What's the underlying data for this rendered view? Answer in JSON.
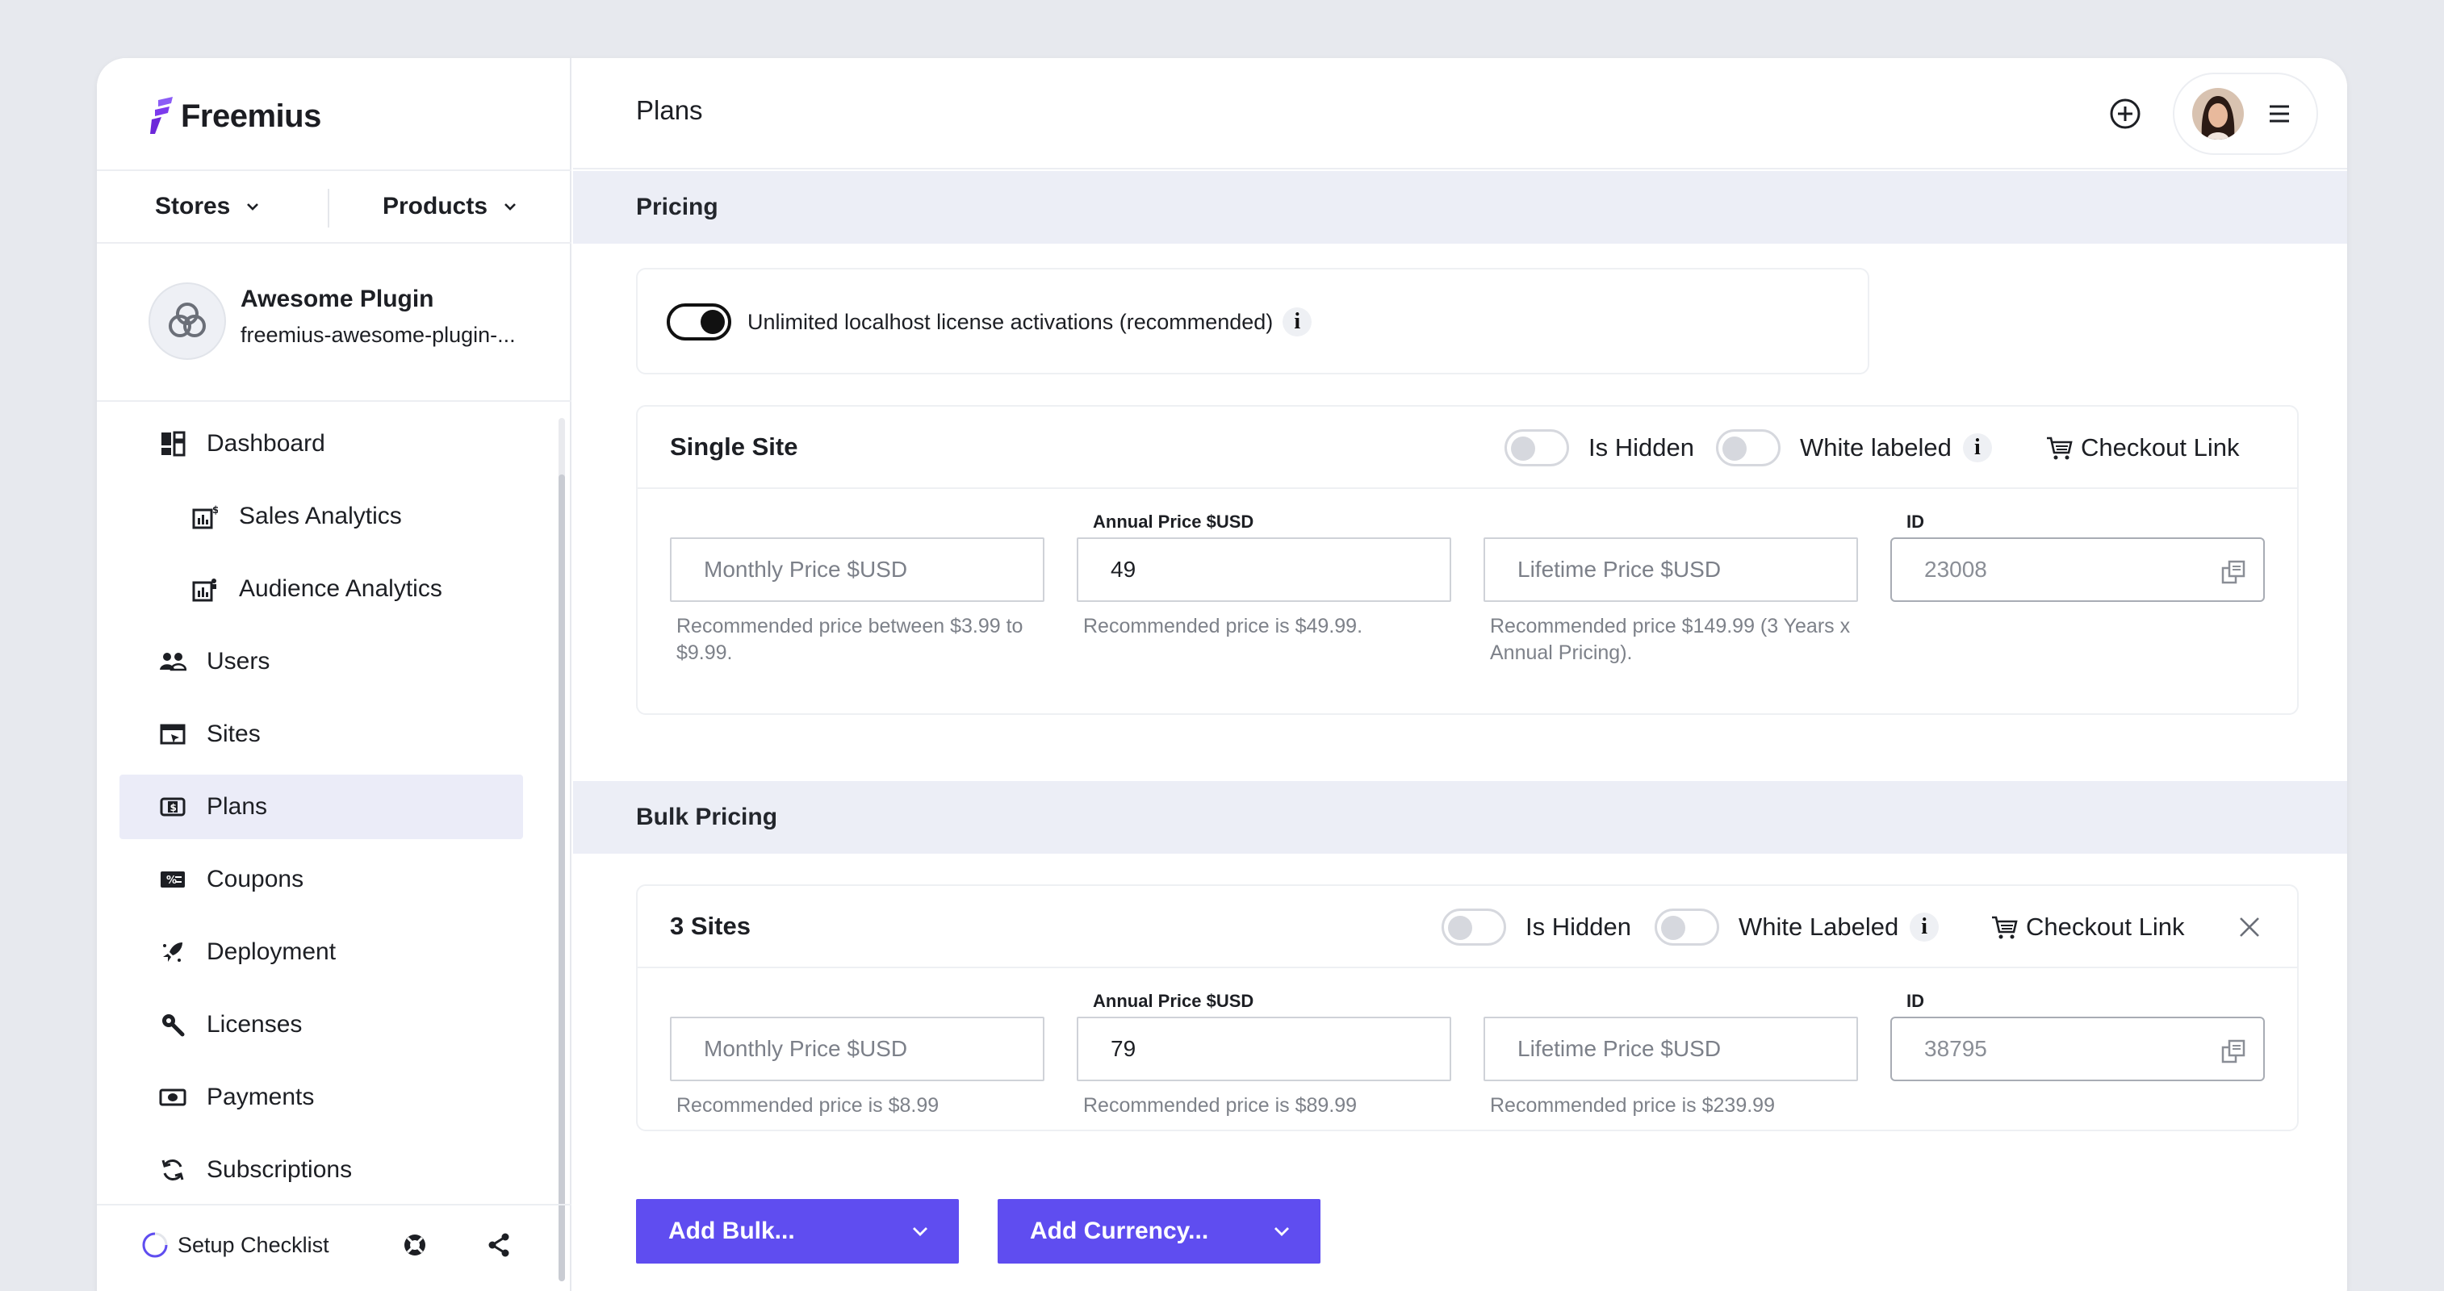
{
  "brand": {
    "name": "Freemius",
    "accent": "#5f4df0"
  },
  "switcher": {
    "stores": "Stores",
    "products": "Products"
  },
  "product": {
    "name": "Awesome Plugin",
    "slug": "freemius-awesome-plugin-..."
  },
  "sidebar": {
    "items": [
      {
        "label": "Dashboard",
        "icon": "dashboard-icon"
      },
      {
        "label": "Sales Analytics",
        "icon": "sales-analytics-icon"
      },
      {
        "label": "Audience Analytics",
        "icon": "audience-analytics-icon"
      },
      {
        "label": "Users",
        "icon": "users-icon"
      },
      {
        "label": "Sites",
        "icon": "sites-icon"
      },
      {
        "label": "Plans",
        "icon": "plans-icon",
        "active": true
      },
      {
        "label": "Coupons",
        "icon": "coupons-icon"
      },
      {
        "label": "Deployment",
        "icon": "deployment-icon"
      },
      {
        "label": "Licenses",
        "icon": "licenses-icon"
      },
      {
        "label": "Payments",
        "icon": "payments-icon"
      },
      {
        "label": "Subscriptions",
        "icon": "subscriptions-icon"
      }
    ]
  },
  "footer": {
    "setup_checklist": "Setup Checklist"
  },
  "header": {
    "title": "Plans"
  },
  "pricing": {
    "section_title": "Pricing",
    "localhost_label": "Unlimited localhost license activations (recommended)",
    "localhost_info": "i"
  },
  "single_site": {
    "title": "Single Site",
    "is_hidden": "Is Hidden",
    "white_labeled": "White labeled",
    "info": "i",
    "checkout_link": "Checkout Link",
    "monthly_placeholder": "Monthly Price $USD",
    "monthly_hint": "Recommended price between $3.99 to $9.99.",
    "annual_label": "Annual Price $USD",
    "annual_value": "49",
    "annual_hint": "Recommended price is $49.99.",
    "lifetime_placeholder": "Lifetime Price $USD",
    "lifetime_hint": "Recommended price $149.99 (3 Years x Annual Pricing).",
    "id_label": "ID",
    "id_value": "23008"
  },
  "bulk": {
    "section_title": "Bulk Pricing",
    "title": "3 Sites",
    "is_hidden": "Is Hidden",
    "white_labeled": "White Labeled",
    "info": "i",
    "checkout_link": "Checkout Link",
    "monthly_placeholder": "Monthly Price $USD",
    "monthly_hint": "Recommended price is $8.99",
    "annual_label": "Annual Price $USD",
    "annual_value": "79",
    "annual_hint": "Recommended price is $89.99",
    "lifetime_placeholder": "Lifetime Price $USD",
    "lifetime_hint": "Recommended price is $239.99",
    "id_label": "ID",
    "id_value": "38795"
  },
  "actions": {
    "add_bulk": "Add Bulk...",
    "add_currency": "Add Currency..."
  }
}
